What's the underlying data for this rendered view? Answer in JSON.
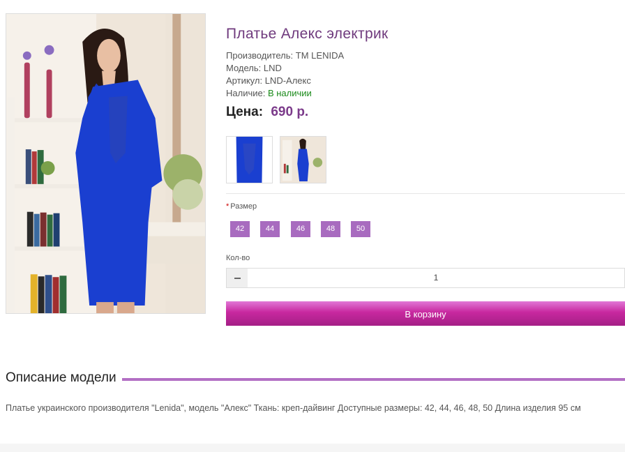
{
  "product": {
    "title": "Платье Алекс электрик",
    "manufacturer_label": "Производитель:",
    "manufacturer": "TM LENIDA",
    "model_label": "Модель:",
    "model": "LND",
    "sku_label": "Артикул:",
    "sku": "LND-Алекс",
    "availability_label": "Наличие:",
    "availability": "В наличии",
    "price_label": "Цена:",
    "price": "690 р."
  },
  "options": {
    "required_mark": "*",
    "size_label": "Размер",
    "sizes": [
      "42",
      "44",
      "46",
      "48",
      "50"
    ]
  },
  "quantity": {
    "label": "Кол-во",
    "value": "1"
  },
  "cart": {
    "button_label": "В корзину"
  },
  "description": {
    "title": "Описание модели",
    "text": "Платье украинского производителя \"Lenida\", модель \"Алекс\" Ткань: креп-дайвинг Доступные размеры: 42, 44, 46, 48, 50 Длина изделия 95 см"
  },
  "colors": {
    "accent": "#a86bbf",
    "title": "#6f3a7d",
    "cart_button": "#c8289f",
    "in_stock": "#1a8a1a"
  }
}
